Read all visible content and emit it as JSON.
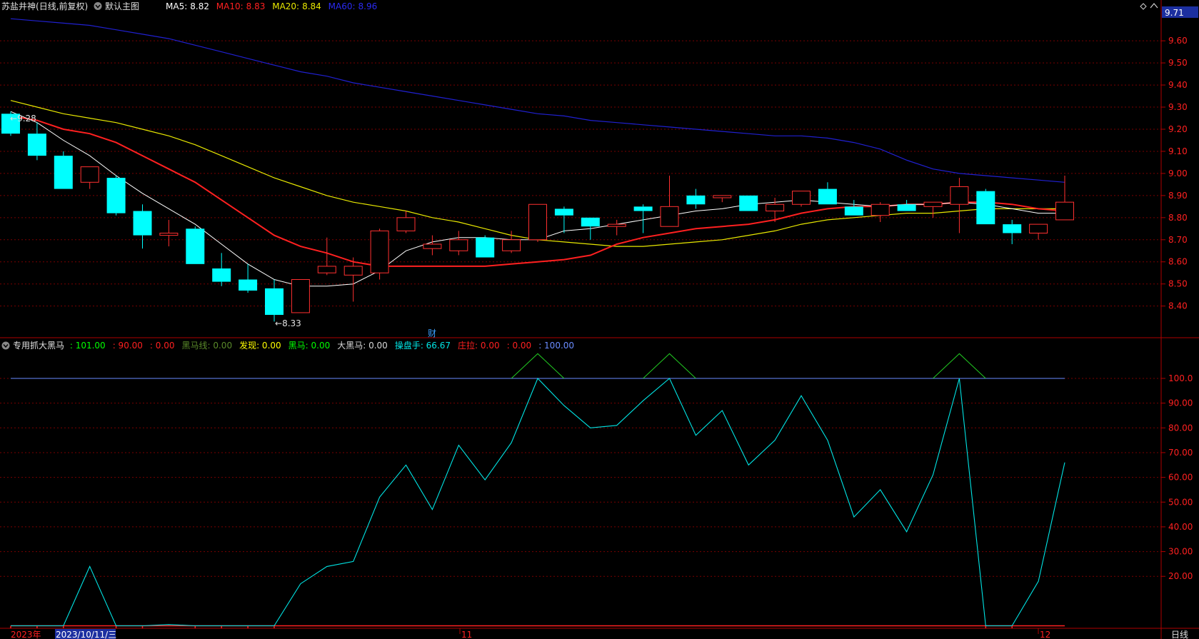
{
  "header": {
    "stock": "苏盐井神",
    "period": "(日线,前复权)",
    "indicator": "默认主图",
    "ma5_label": "MA5:",
    "ma5_value": "8.82",
    "ma10_label": "MA10:",
    "ma10_value": "8.83",
    "ma20_label": "MA20:",
    "ma20_value": "8.84",
    "ma60_label": "MA60:",
    "ma60_value": "8.96"
  },
  "main_panel": {
    "price_max_label": "9.71",
    "y_ticks": [
      "9.60",
      "9.50",
      "9.40",
      "9.30",
      "9.20",
      "9.10",
      "9.00",
      "8.90",
      "8.80",
      "8.70",
      "8.60",
      "8.50",
      "8.40"
    ],
    "high_marker": "9.28",
    "low_marker": "8.33",
    "finance_marker": "财"
  },
  "sub_panel": {
    "indicator_name": "专用抓大黑马",
    "legend": [
      {
        "label": "",
        "value": ": 101.00",
        "color": "#00ff00"
      },
      {
        "label": "",
        "value": ": 90.00",
        "color": "#ff2020"
      },
      {
        "label": "",
        "value": ": 0.00",
        "color": "#ff2020"
      },
      {
        "label": "黑马线:",
        "value": " 0.00",
        "color": "#5a8a2a"
      },
      {
        "label": "发现:",
        "value": " 0.00",
        "color": "#ffff00"
      },
      {
        "label": "黑马:",
        "value": " 0.00",
        "color": "#00ff00"
      },
      {
        "label": "大黑马:",
        "value": " 0.00",
        "color": "#d8d8d8"
      },
      {
        "label": "操盘手:",
        "value": " 66.67",
        "color": "#00e5e5"
      },
      {
        "label": "庄拉:",
        "value": " 0.00",
        "color": "#ff2020"
      },
      {
        "label": "",
        "value": ": 0.00",
        "color": "#ff2020"
      },
      {
        "label": "",
        "value": ": 100.00",
        "color": "#6a8cff"
      }
    ],
    "y_ticks": [
      "100.0",
      "90.00",
      "80.00",
      "70.00",
      "60.00",
      "50.00",
      "40.00",
      "30.00",
      "20.00"
    ]
  },
  "x_axis": {
    "year_label": "2023年",
    "cursor_date": "2023/10/11/三",
    "month_11": "11",
    "month_12": "12",
    "period_button": "日线"
  },
  "colors": {
    "up": "#ff3030",
    "down": "#00ffff",
    "ma5": "#ffffff",
    "ma10": "#ff2020",
    "ma20": "#e8e800",
    "ma60": "#2020d0",
    "grid": "#7a0000",
    "axis": "#b00000"
  },
  "chart_data": {
    "type": "candlestick",
    "candles": [
      {
        "o": 9.27,
        "h": 9.28,
        "l": 9.17,
        "c": 9.18
      },
      {
        "o": 9.18,
        "h": 9.23,
        "l": 9.06,
        "c": 9.08
      },
      {
        "o": 9.08,
        "h": 9.1,
        "l": 8.93,
        "c": 8.93
      },
      {
        "o": 8.96,
        "h": 9.03,
        "l": 8.93,
        "c": 9.03
      },
      {
        "o": 8.98,
        "h": 8.99,
        "l": 8.81,
        "c": 8.82
      },
      {
        "o": 8.83,
        "h": 8.86,
        "l": 8.66,
        "c": 8.72
      },
      {
        "o": 8.72,
        "h": 8.79,
        "l": 8.67,
        "c": 8.73
      },
      {
        "o": 8.75,
        "h": 8.76,
        "l": 8.59,
        "c": 8.59
      },
      {
        "o": 8.57,
        "h": 8.64,
        "l": 8.49,
        "c": 8.51
      },
      {
        "o": 8.52,
        "h": 8.59,
        "l": 8.46,
        "c": 8.47
      },
      {
        "o": 8.48,
        "h": 8.52,
        "l": 8.33,
        "c": 8.36
      },
      {
        "o": 8.37,
        "h": 8.52,
        "l": 8.37,
        "c": 8.52
      },
      {
        "o": 8.55,
        "h": 8.71,
        "l": 8.54,
        "c": 8.58
      },
      {
        "o": 8.54,
        "h": 8.62,
        "l": 8.42,
        "c": 8.58
      },
      {
        "o": 8.55,
        "h": 8.75,
        "l": 8.52,
        "c": 8.74
      },
      {
        "o": 8.74,
        "h": 8.83,
        "l": 8.73,
        "c": 8.8
      },
      {
        "o": 8.66,
        "h": 8.72,
        "l": 8.63,
        "c": 8.68
      },
      {
        "o": 8.65,
        "h": 8.74,
        "l": 8.63,
        "c": 8.7
      },
      {
        "o": 8.71,
        "h": 8.72,
        "l": 8.62,
        "c": 8.62
      },
      {
        "o": 8.65,
        "h": 8.74,
        "l": 8.64,
        "c": 8.7
      },
      {
        "o": 8.7,
        "h": 8.86,
        "l": 8.69,
        "c": 8.86
      },
      {
        "o": 8.84,
        "h": 8.85,
        "l": 8.73,
        "c": 8.81
      },
      {
        "o": 8.8,
        "h": 8.8,
        "l": 8.7,
        "c": 8.76
      },
      {
        "o": 8.76,
        "h": 8.79,
        "l": 8.72,
        "c": 8.77
      },
      {
        "o": 8.85,
        "h": 8.86,
        "l": 8.73,
        "c": 8.83
      },
      {
        "o": 8.76,
        "h": 8.99,
        "l": 8.76,
        "c": 8.85
      },
      {
        "o": 8.9,
        "h": 8.93,
        "l": 8.84,
        "c": 8.86
      },
      {
        "o": 8.89,
        "h": 8.9,
        "l": 8.87,
        "c": 8.9
      },
      {
        "o": 8.9,
        "h": 8.9,
        "l": 8.83,
        "c": 8.83
      },
      {
        "o": 8.83,
        "h": 8.89,
        "l": 8.78,
        "c": 8.86
      },
      {
        "o": 8.86,
        "h": 8.92,
        "l": 8.85,
        "c": 8.92
      },
      {
        "o": 8.93,
        "h": 8.96,
        "l": 8.86,
        "c": 8.86
      },
      {
        "o": 8.85,
        "h": 8.88,
        "l": 8.81,
        "c": 8.81
      },
      {
        "o": 8.81,
        "h": 8.87,
        "l": 8.78,
        "c": 8.86
      },
      {
        "o": 8.86,
        "h": 8.88,
        "l": 8.83,
        "c": 8.83
      },
      {
        "o": 8.85,
        "h": 8.87,
        "l": 8.8,
        "c": 8.87
      },
      {
        "o": 8.86,
        "h": 8.98,
        "l": 8.73,
        "c": 8.94
      },
      {
        "o": 8.92,
        "h": 8.93,
        "l": 8.77,
        "c": 8.77
      },
      {
        "o": 8.77,
        "h": 8.79,
        "l": 8.68,
        "c": 8.73
      },
      {
        "o": 8.73,
        "h": 8.77,
        "l": 8.7,
        "c": 8.77
      },
      {
        "o": 8.79,
        "h": 8.99,
        "l": 8.79,
        "c": 8.87
      }
    ],
    "ma5": [
      9.28,
      9.23,
      9.15,
      9.08,
      8.99,
      8.91,
      8.84,
      8.77,
      8.68,
      8.59,
      8.52,
      8.49,
      8.49,
      8.5,
      8.56,
      8.65,
      8.69,
      8.71,
      8.71,
      8.7,
      8.7,
      8.74,
      8.75,
      8.77,
      8.79,
      8.81,
      8.83,
      8.84,
      8.86,
      8.87,
      8.88,
      8.87,
      8.86,
      8.85,
      8.86,
      8.86,
      8.87,
      8.86,
      8.84,
      8.82,
      8.82
    ],
    "ma10": [
      9.26,
      9.24,
      9.2,
      9.18,
      9.14,
      9.08,
      9.02,
      8.96,
      8.88,
      8.8,
      8.72,
      8.67,
      8.64,
      8.6,
      8.58,
      8.58,
      8.58,
      8.58,
      8.58,
      8.59,
      8.6,
      8.61,
      8.63,
      8.68,
      8.71,
      8.73,
      8.75,
      8.76,
      8.77,
      8.79,
      8.82,
      8.84,
      8.85,
      8.85,
      8.86,
      8.86,
      8.87,
      8.87,
      8.86,
      8.84,
      8.83
    ],
    "ma20": [
      9.33,
      9.3,
      9.27,
      9.25,
      9.23,
      9.2,
      9.17,
      9.13,
      9.08,
      9.03,
      8.98,
      8.94,
      8.9,
      8.87,
      8.85,
      8.83,
      8.8,
      8.78,
      8.75,
      8.72,
      8.7,
      8.69,
      8.68,
      8.67,
      8.67,
      8.68,
      8.69,
      8.7,
      8.72,
      8.74,
      8.77,
      8.79,
      8.8,
      8.81,
      8.82,
      8.82,
      8.83,
      8.84,
      8.84,
      8.84,
      8.84
    ],
    "ma60": [
      9.7,
      9.69,
      9.68,
      9.67,
      9.65,
      9.63,
      9.61,
      9.58,
      9.55,
      9.52,
      9.49,
      9.46,
      9.44,
      9.41,
      9.39,
      9.37,
      9.35,
      9.33,
      9.31,
      9.29,
      9.27,
      9.26,
      9.24,
      9.23,
      9.22,
      9.21,
      9.2,
      9.19,
      9.18,
      9.17,
      9.17,
      9.16,
      9.14,
      9.11,
      9.06,
      9.02,
      9.0,
      8.99,
      8.98,
      8.97,
      8.96
    ],
    "operator_line": [
      0,
      0,
      0,
      24,
      0,
      0,
      0.5,
      0,
      0,
      0,
      0,
      17,
      24,
      26,
      52,
      65,
      47,
      73,
      59,
      74,
      100,
      89,
      80,
      81,
      91,
      100,
      77,
      87,
      65,
      75,
      93,
      75,
      44,
      55,
      38,
      61,
      100,
      0,
      0,
      18,
      66
    ],
    "zhuangla_bars": [
      1,
      1,
      1,
      0,
      1,
      1,
      0,
      1,
      1,
      1,
      1,
      0,
      0,
      0,
      0,
      0,
      0,
      0,
      0,
      0,
      0,
      0,
      0,
      0,
      0,
      0,
      0,
      0,
      0,
      0,
      0,
      0,
      0,
      0,
      0,
      0,
      0,
      1,
      1,
      0,
      0
    ],
    "signal_peaks": [
      20,
      25,
      36
    ],
    "reference_line": 100,
    "price_range": [
      8.26,
      9.72
    ],
    "sub_range": [
      -1,
      115
    ]
  }
}
